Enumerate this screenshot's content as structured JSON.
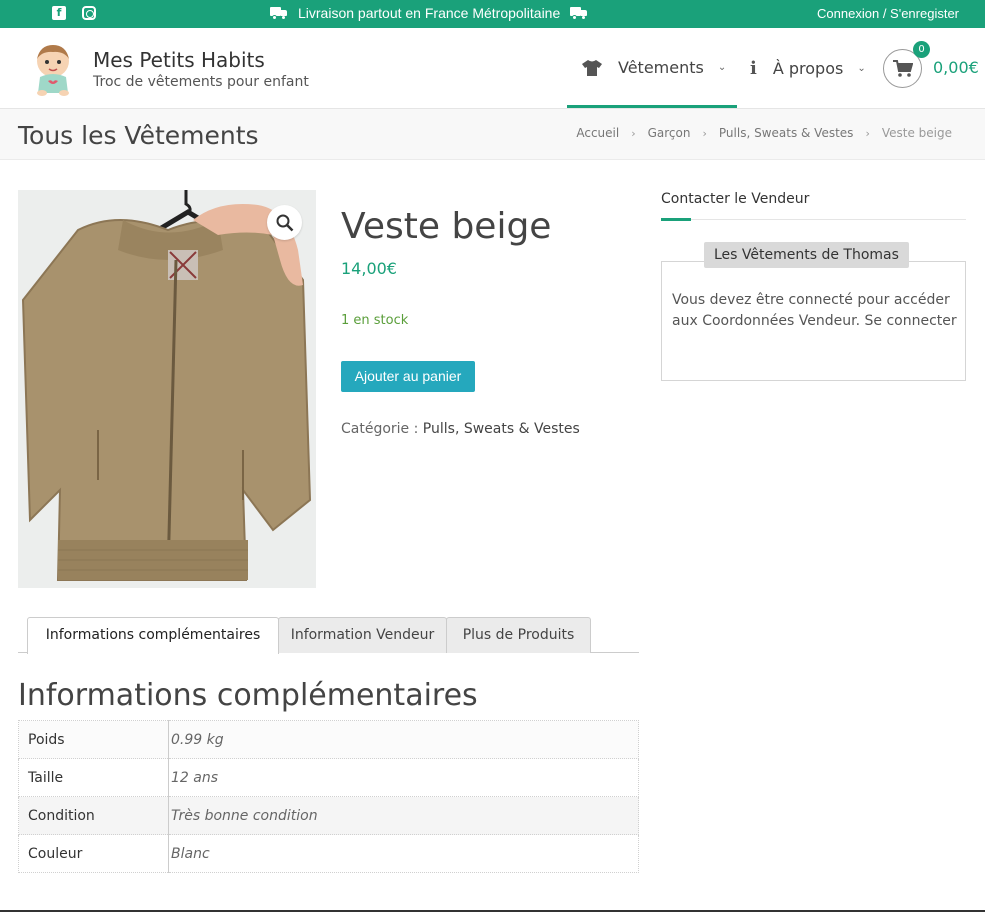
{
  "topbar": {
    "delivery": "Livraison partout en France Métropolitaine",
    "login": "Connexion / S'enregister",
    "social": [
      "facebook-icon",
      "instagram-icon"
    ]
  },
  "header": {
    "site_title": "Mes Petits Habits",
    "tagline": "Troc de vêtements pour enfant",
    "nav": [
      {
        "label": "Vêtements",
        "icon": "tshirt-icon"
      },
      {
        "label": "À propos",
        "icon": "info-icon"
      }
    ],
    "cart": {
      "count": "0",
      "total": "0,00€"
    }
  },
  "titlebar": {
    "title": "Tous les Vêtements",
    "breadcrumb": [
      "Accueil",
      "Garçon",
      "Pulls, Sweats & Vestes",
      "Veste beige"
    ]
  },
  "product": {
    "title": "Veste beige",
    "price": "14,00€",
    "stock": "1 en stock",
    "add_to_cart": "Ajouter au panier",
    "category_label": "Catégorie :",
    "category_value": "Pulls, Sweats & Vestes"
  },
  "sidebar": {
    "widget_title": "Contacter le Vendeur",
    "vendor_name": "Les Vêtements de Thomas",
    "message": "Vous devez être connecté pour accéder aux Coordonnées Vendeur. Se connecter"
  },
  "tabs": [
    {
      "label": "Informations complémentaires"
    },
    {
      "label": "Information Vendeur"
    },
    {
      "label": "Plus de Produits"
    }
  ],
  "info": {
    "heading": "Informations complémentaires",
    "rows": [
      {
        "label": "Poids",
        "value": "0.99 kg"
      },
      {
        "label": "Taille",
        "value": "12 ans"
      },
      {
        "label": "Condition",
        "value": "Très bonne condition"
      },
      {
        "label": "Couleur",
        "value": "Blanc"
      }
    ]
  },
  "colors": {
    "accent": "#1aa17a",
    "button": "#25a8bd",
    "stock": "#5a9e3a"
  }
}
